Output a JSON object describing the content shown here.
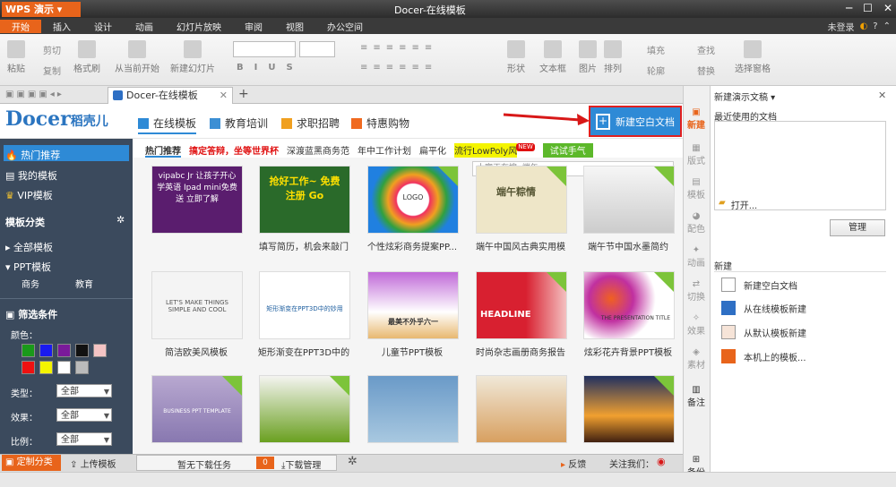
{
  "app": {
    "menu_button": "WPS 演示",
    "window_title": "Docer-在线模板"
  },
  "menu": [
    "开始",
    "插入",
    "设计",
    "动画",
    "幻灯片放映",
    "审阅",
    "视图",
    "办公空间"
  ],
  "account": {
    "login": "未登录"
  },
  "ribbon": {
    "paste": "粘贴",
    "cut": "剪切",
    "copy": "复制",
    "format_painter": "格式刷",
    "from_current": "从当前开始",
    "new_slide": "新建幻灯片",
    "shape": "形状",
    "textbox": "文本框",
    "picture": "图片",
    "arrange": "排列",
    "fill": "填充",
    "outline": "轮廓",
    "find": "查找",
    "replace": "替换",
    "select_pane": "选择窗格"
  },
  "tabs": {
    "doc_tab": "Docer-在线模板",
    "add": "+"
  },
  "header": {
    "logo_main": "Docer",
    "logo_sub": "稻壳儿",
    "nav": [
      "在线模板",
      "教育培训",
      "求职招聘",
      "特惠购物"
    ],
    "new_blank": "新建空白文档"
  },
  "sidebar": {
    "hot": "热门推荐",
    "mine": "我的模板",
    "vip": "VIP模板",
    "category_title": "模板分类",
    "all": "全部模板",
    "ppt": "PPT模板",
    "business": "商务",
    "education": "教育",
    "filter_title": "筛选条件",
    "color_label": "颜色：",
    "type_label": "类型：",
    "effect_label": "效果：",
    "ratio_label": "比例：",
    "all_option": "全部",
    "colors": [
      "#1a9a1a",
      "#1a1af0",
      "#7a1a9a",
      "#111111",
      "#f4c4c4",
      "#ee1111",
      "#f4f400",
      "#ffffff",
      "#bbbbbb"
    ]
  },
  "tagbar": [
    "热门推荐",
    "搞定答辩，坐等世界杯",
    "深渡蓝黑商务范",
    "年中工作计划",
    "扁平化",
    "流行LowPoly风",
    "NEW",
    "试试手气"
  ],
  "search": {
    "placeholder": "大家正在搜: 端午"
  },
  "cards": [
    {
      "caption": "",
      "text": "vipabc Jr 让孩子开心 学英语 Ipad mini免费送 立即了解",
      "vip": false
    },
    {
      "caption": "填写简历，机会来敲门",
      "text": "抢好工作~ 免费注册 Go",
      "vip": false
    },
    {
      "caption": "个性炫彩商务提案PP...",
      "text": "LOGO",
      "vip": true
    },
    {
      "caption": "端午中国风古典实用模",
      "text": "端午粽情",
      "vip": true
    },
    {
      "caption": "端午节中国水墨简约",
      "text": "",
      "vip": true
    },
    {
      "caption": "简洁欧美风模板",
      "text": "LET'S MAKE THINGS SIMPLE AND COOL",
      "vip": false
    },
    {
      "caption": "矩形渐变在PPT3D中的",
      "text": "矩形渐变在PPT3D中的妙用",
      "vip": false
    },
    {
      "caption": "儿童节PPT模板",
      "text": "最美不外乎六一",
      "vip": false
    },
    {
      "caption": "时尚杂志画册商务报告",
      "text": "HEADLINE",
      "vip": true
    },
    {
      "caption": "炫彩花卉背景PPT模板",
      "text": "THE PRESENTATION TITLE",
      "vip": true
    },
    {
      "caption": "",
      "text": "BUSINESS PPT TEMPLATE",
      "vip": true
    },
    {
      "caption": "",
      "text": "",
      "vip": true
    },
    {
      "caption": "",
      "text": "",
      "vip": false
    },
    {
      "caption": "",
      "text": "",
      "vip": false
    },
    {
      "caption": "",
      "text": "",
      "vip": true
    }
  ],
  "rail": [
    "新建",
    "版式",
    "模板",
    "配色",
    "动画",
    "切换",
    "效果",
    "素材",
    "备注",
    "备份"
  ],
  "panel": {
    "title": "新建演示文稿",
    "recent": "最近使用的文档",
    "open": "打开...",
    "manage": "管理",
    "new_section": "新建",
    "items": [
      "新建空白文档",
      "从在线模板新建",
      "从默认模板新建",
      "本机上的模板..."
    ]
  },
  "bottom": {
    "custom": "定制分类",
    "upload": "上传模板",
    "no_task": "暂无下载任务",
    "count": "0",
    "manager": "下载管理",
    "feedback": "反馈",
    "follow": "关注我们："
  }
}
